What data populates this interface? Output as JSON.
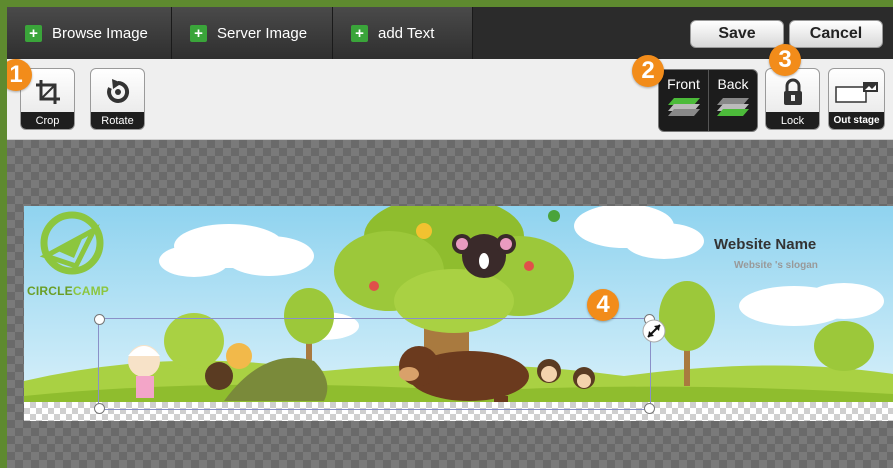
{
  "topbar": {
    "browse_label": "Browse Image",
    "server_label": "Server Image",
    "text_label": "add Text",
    "save_label": "Save",
    "cancel_label": "Cancel"
  },
  "tools": {
    "crop_label": "Crop",
    "rotate_label": "Rotate",
    "front_label": "Front",
    "back_label": "Back",
    "lock_label": "Lock",
    "outstage_label": "Out stage"
  },
  "badges": [
    "1",
    "2",
    "3",
    "4"
  ],
  "banner": {
    "site_name": "Website Name",
    "site_slogan": "Website 's slogan",
    "logo_part1": "CIRCLE",
    "logo_part2": "CAMP"
  },
  "colors": {
    "accent_orange": "#f28c1a",
    "plus_green": "#3aa53a",
    "logo_green": "#8cc63f"
  }
}
